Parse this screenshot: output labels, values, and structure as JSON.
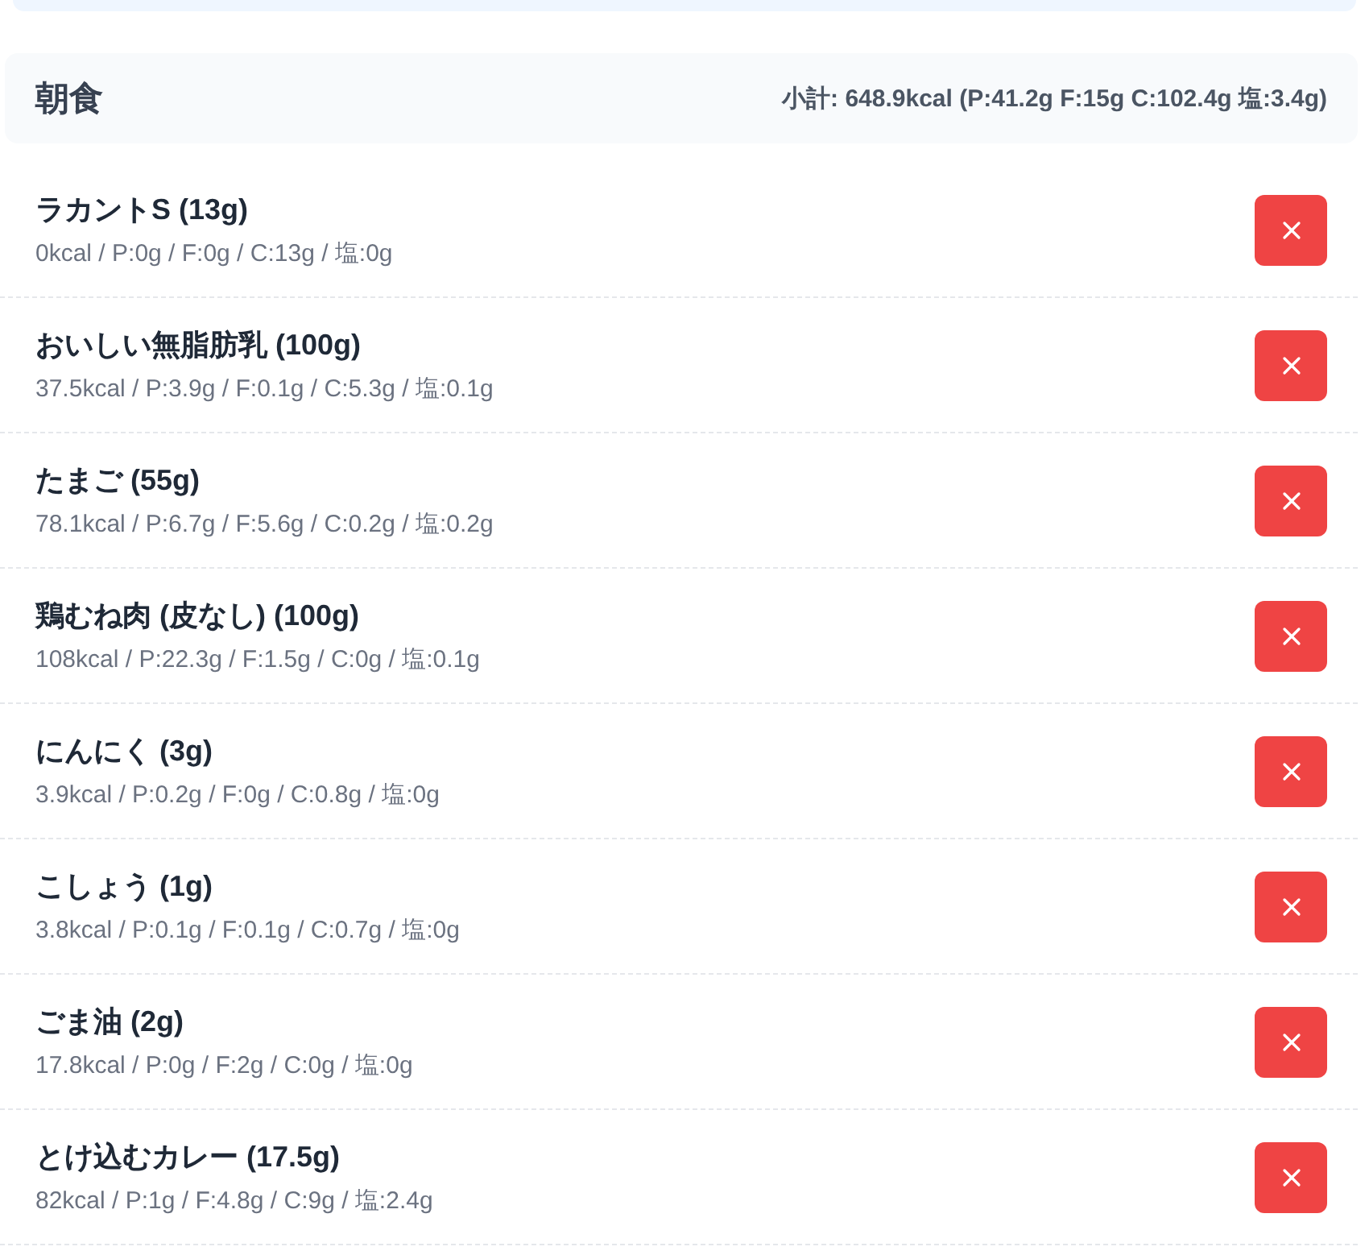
{
  "meal": {
    "title": "朝食",
    "subtotal": "小計: 648.9kcal (P:41.2g F:15g C:102.4g 塩:3.4g)"
  },
  "items": [
    {
      "name": "ラカントS (13g)",
      "nutrition": "0kcal / P:0g / F:0g / C:13g / 塩:0g"
    },
    {
      "name": "おいしい無脂肪乳 (100g)",
      "nutrition": "37.5kcal / P:3.9g / F:0.1g / C:5.3g / 塩:0.1g"
    },
    {
      "name": "たまご (55g)",
      "nutrition": "78.1kcal / P:6.7g / F:5.6g / C:0.2g / 塩:0.2g"
    },
    {
      "name": "鶏むね肉 (皮なし) (100g)",
      "nutrition": "108kcal / P:22.3g / F:1.5g / C:0g / 塩:0.1g"
    },
    {
      "name": "にんにく (3g)",
      "nutrition": "3.9kcal / P:0.2g / F:0g / C:0.8g / 塩:0g"
    },
    {
      "name": "こしょう (1g)",
      "nutrition": "3.8kcal / P:0.1g / F:0.1g / C:0.7g / 塩:0g"
    },
    {
      "name": "ごま油 (2g)",
      "nutrition": "17.8kcal / P:0g / F:2g / C:0g / 塩:0g"
    },
    {
      "name": "とけ込むカレー (17.5g)",
      "nutrition": "82kcal / P:1g / F:4.8g / C:9g / 塩:2.4g"
    }
  ]
}
